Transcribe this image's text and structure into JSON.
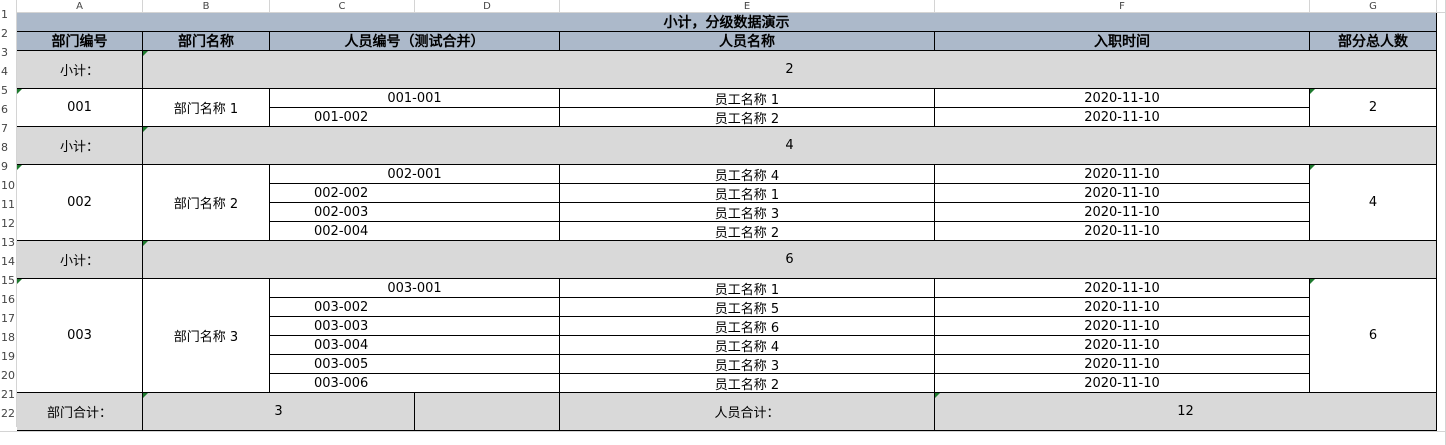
{
  "columns": [
    "A",
    "B",
    "C",
    "D",
    "E",
    "F",
    "G"
  ],
  "rows": [
    "1",
    "2",
    "3",
    "4",
    "5",
    "6",
    "7",
    "8",
    "9",
    "10",
    "11",
    "12",
    "13",
    "14",
    "15",
    "16",
    "17",
    "18",
    "19",
    "20",
    "21",
    "22"
  ],
  "title": "小计，分级数据演示",
  "headers": {
    "dept_code": "部门编号",
    "dept_name": "部门名称",
    "person_code": "人员编号（测试合并）",
    "person_name": "人员名称",
    "entry_time": "入职时间",
    "dept_total": "部分总人数"
  },
  "subtotal_label": "小计：",
  "groups": [
    {
      "subtotal": "2",
      "code": "001",
      "name": "部门名称 1",
      "count": "2",
      "people": [
        {
          "code": "001-001",
          "name": "员工名称 1",
          "date": "2020-11-10"
        },
        {
          "code": "001-002",
          "name": "员工名称 2",
          "date": "2020-11-10"
        }
      ]
    },
    {
      "subtotal": "4",
      "code": "002",
      "name": "部门名称 2",
      "count": "4",
      "people": [
        {
          "code": "002-001",
          "name": "员工名称 4",
          "date": "2020-11-10"
        },
        {
          "code": "002-002",
          "name": "员工名称 1",
          "date": "2020-11-10"
        },
        {
          "code": "002-003",
          "name": "员工名称 3",
          "date": "2020-11-10"
        },
        {
          "code": "002-004",
          "name": "员工名称 2",
          "date": "2020-11-10"
        }
      ]
    },
    {
      "subtotal": "6",
      "code": "003",
      "name": "部门名称 3",
      "count": "6",
      "people": [
        {
          "code": "003-001",
          "name": "员工名称 1",
          "date": "2020-11-10"
        },
        {
          "code": "003-002",
          "name": "员工名称 5",
          "date": "2020-11-10"
        },
        {
          "code": "003-003",
          "name": "员工名称 6",
          "date": "2020-11-10"
        },
        {
          "code": "003-004",
          "name": "员工名称 4",
          "date": "2020-11-10"
        },
        {
          "code": "003-005",
          "name": "员工名称 3",
          "date": "2020-11-10"
        },
        {
          "code": "003-006",
          "name": "员工名称 2",
          "date": "2020-11-10"
        }
      ]
    }
  ],
  "footer": {
    "dept_total_label": "部门合计：",
    "dept_total_value": "3",
    "person_total_label": "人员合计：",
    "person_total_value": "12"
  }
}
